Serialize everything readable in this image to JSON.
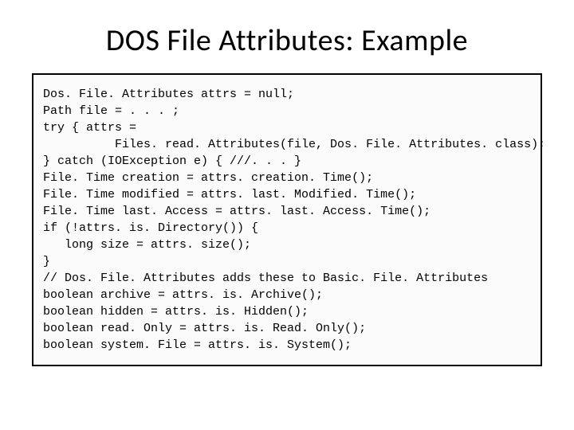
{
  "title": "DOS File Attributes: Example",
  "code": {
    "l1": "Dos. File. Attributes attrs = null;",
    "l2": "Path file = . . . ;",
    "l3": "try { attrs =",
    "l4": "          Files. read. Attributes(file, Dos. File. Attributes. class);",
    "l5": "} catch (IOException e) { ///. . . }",
    "l6": "File. Time creation = attrs. creation. Time();",
    "l7": "File. Time modified = attrs. last. Modified. Time();",
    "l8": "File. Time last. Access = attrs. last. Access. Time();",
    "l9": "if (!attrs. is. Directory()) {",
    "l10": "   long size = attrs. size();",
    "l11": "}",
    "l12": "// Dos. File. Attributes adds these to Basic. File. Attributes",
    "l13": "boolean archive = attrs. is. Archive();",
    "l14": "boolean hidden = attrs. is. Hidden();",
    "l15": "boolean read. Only = attrs. is. Read. Only();",
    "l16": "boolean system. File = attrs. is. System();"
  }
}
